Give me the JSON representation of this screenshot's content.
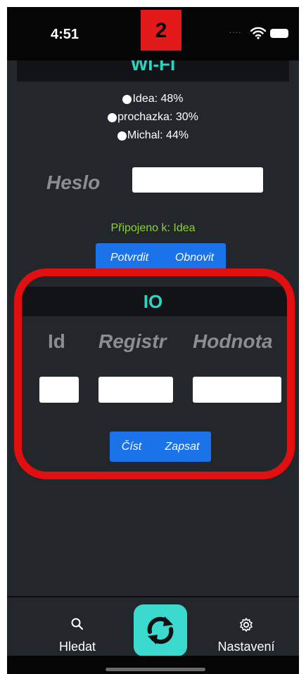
{
  "status_bar": {
    "time": "4:51",
    "step_badge": "2",
    "signal_dots": "....",
    "badge_color": "#e21a1a"
  },
  "wifi": {
    "title": "WI-FI",
    "networks": [
      {
        "label": "Idea: 48%"
      },
      {
        "label": "prochazka: 30%"
      },
      {
        "label": "Michal: 44%"
      }
    ],
    "password_label": "Heslo",
    "password_value": "",
    "connected_status": "Připojeno k: Idea",
    "confirm_label": "Potvrdit",
    "refresh_label": "Obnovit"
  },
  "io": {
    "title": "IO",
    "id_label": "Id",
    "register_label": "Registr",
    "value_label": "Hodnota",
    "id_value": "",
    "register_value": "",
    "value_value": "",
    "read_label": "Číst",
    "write_label": "Zapsat",
    "highlight_color": "#e10f0f"
  },
  "tab_bar": {
    "search_label": "Hledat",
    "settings_label": "Nastavení",
    "search_icon": "search-icon",
    "center_icon": "sync-icon",
    "settings_icon": "gear-icon"
  },
  "theme": {
    "background": "#23262b",
    "accent": "#2ad5c3",
    "button": "#1a73e8",
    "success": "#8bd42c"
  }
}
